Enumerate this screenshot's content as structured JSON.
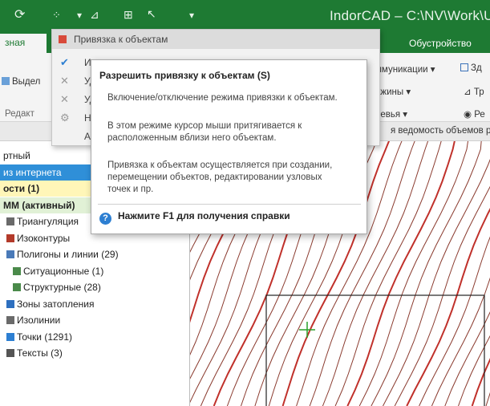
{
  "titlebar": {
    "back_glyph": "⟳",
    "dropdown_glyph": "▾",
    "title": "IndorCAD – C:\\NV\\Work\\Uni"
  },
  "tabs": {
    "active": "зная",
    "right": "Обустройство"
  },
  "ribbon": {
    "items": {
      "communications": "ммуникации",
      "building": "Зд",
      "wells": "ажины",
      "tr": "Тр",
      "pipes": "невья",
      "re": "Ре",
      "select": "Выдел",
      "group_edit": "Редакт"
    }
  },
  "docstrip": {
    "tab": "я ведомость объемов р"
  },
  "menu": {
    "header": "Привязка к объектам",
    "items": [
      {
        "label": "Ис",
        "icon": "check-icon"
      },
      {
        "label": "Уд",
        "icon": "delete-icon"
      },
      {
        "label": "Уд",
        "icon": "delete-icon"
      },
      {
        "label": "На",
        "icon": "settings-icon"
      },
      {
        "label": "Ав",
        "icon": ""
      }
    ]
  },
  "tooltip": {
    "title": "Разрешить привязку к объектам (S)",
    "p1": "Включение/отключение режима привязки к объектам.",
    "p2": "В этом режиме курсор мыши притягивается к расположенным вблизи него объектам.",
    "p3": "Привязка к объектам осуществляется при создании, перемещении объектов, редактировании узловых точек и пр.",
    "help": "Нажмите F1 для получения справки"
  },
  "leftpanel": {
    "rows": [
      {
        "label": "ртный",
        "style": ""
      },
      {
        "label": "из интернета",
        "style": "sel"
      },
      {
        "label": "ости (1)",
        "style": "bold"
      },
      {
        "label": "ММ (активный)",
        "style": "green"
      },
      {
        "label": "Триангуляция",
        "style": ""
      },
      {
        "label": "Изоконтуры",
        "style": ""
      },
      {
        "label": "Полигоны и линии (29)",
        "style": ""
      },
      {
        "label": "Ситуационные (1)",
        "style": ""
      },
      {
        "label": "Структурные (28)",
        "style": ""
      },
      {
        "label": "Зоны затопления",
        "style": ""
      },
      {
        "label": "Изолинии",
        "style": ""
      },
      {
        "label": "Точки (1291)",
        "style": ""
      },
      {
        "label": "Тексты (3)",
        "style": ""
      }
    ]
  },
  "colors": {
    "brand": "#1e7a33",
    "selection": "#2f8fd8",
    "contour_red": "#c0312b",
    "contour_thin": "#8a3a2e"
  }
}
